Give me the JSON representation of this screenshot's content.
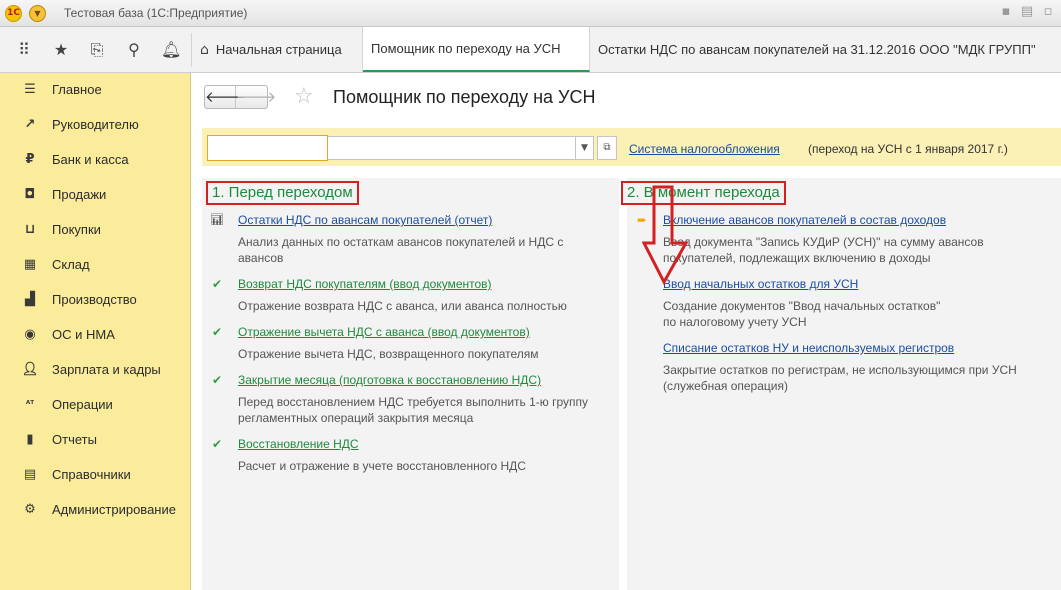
{
  "window": {
    "title": "Тестовая база  (1С:Предприятие)",
    "logo_text": "1С"
  },
  "toolbar": {
    "icons": [
      "grid-icon",
      "star-icon",
      "history-icon",
      "search-icon",
      "bell-icon"
    ]
  },
  "tabs": [
    {
      "label": "Начальная страница",
      "icon": "home-icon",
      "active": false
    },
    {
      "label": "Помощник по переходу на УСН",
      "active": true
    },
    {
      "label": "Остатки НДС по авансам покупателей на 31.12.2016 ООО \"МДК ГРУПП\"",
      "active": false
    }
  ],
  "sidebar": {
    "items": [
      {
        "label": "Главное",
        "icon": "menu-lines-icon"
      },
      {
        "label": "Руководителю",
        "icon": "trend-icon"
      },
      {
        "label": "Банк и касса",
        "icon": "ruble-icon"
      },
      {
        "label": "Продажи",
        "icon": "bag-icon"
      },
      {
        "label": "Покупки",
        "icon": "cart-icon"
      },
      {
        "label": "Склад",
        "icon": "warehouse-icon"
      },
      {
        "label": "Производство",
        "icon": "factory-icon"
      },
      {
        "label": "ОС и НМА",
        "icon": "assets-icon"
      },
      {
        "label": "Зарплата и кадры",
        "icon": "person-icon"
      },
      {
        "label": "Операции",
        "icon": "operations-icon"
      },
      {
        "label": "Отчеты",
        "icon": "bar-chart-icon"
      },
      {
        "label": "Справочники",
        "icon": "book-icon"
      },
      {
        "label": "Администрирование",
        "icon": "gear-icon"
      }
    ]
  },
  "page": {
    "title": "Помощник по переходу на УСН",
    "filter": {
      "value": "",
      "link": "Система налогообложения",
      "note": "(переход на УСН с 1 января 2017 г.)"
    },
    "left": {
      "heading": "1. Перед переходом",
      "steps": [
        {
          "status": "report",
          "link": "Остатки НДС по авансам покупателей (отчет)",
          "desc": [
            "Анализ данных по остаткам авансов покупателей и НДС с",
            "авансов"
          ]
        },
        {
          "status": "done",
          "link": "Возврат НДС покупателям (ввод документов)",
          "desc": [
            "Отражение возврата НДС с аванса, или аванса полностью"
          ]
        },
        {
          "status": "done",
          "link": "Отражение вычета НДС с аванса (ввод документов)",
          "desc": [
            "Отражение вычета НДС, возвращенного покупателям"
          ]
        },
        {
          "status": "done",
          "link": "Закрытие месяца (подготовка к восстановлению НДС)",
          "desc": [
            "Перед восстановлением НДС требуется выполнить 1-ю группу",
            "регламентных операций закрытия месяца"
          ]
        },
        {
          "status": "done",
          "link": "Восстановление НДС",
          "desc": [
            "Расчет и отражение в учете восстановленного НДС"
          ]
        }
      ]
    },
    "right": {
      "heading": "2. В момент перехода",
      "steps": [
        {
          "status": "current",
          "link": "Включение авансов покупателей в состав доходов",
          "desc": [
            "Ввод документа \"Запись КУДиР (УСН)\" на сумму авансов",
            "покупателей, подлежащих включению в доходы"
          ]
        },
        {
          "status": "none",
          "link": "Ввод начальных остатков для УСН",
          "desc": [
            "Создание документов \"Ввод начальных остатков\"",
            "по налоговому учету УСН"
          ]
        },
        {
          "status": "none",
          "link": "Списание остатков НУ и неиспользуемых регистров",
          "desc": [
            "Закрытие остатков по  регистрам, не использующимся при УСН",
            "(служебная операция)"
          ]
        }
      ]
    }
  }
}
